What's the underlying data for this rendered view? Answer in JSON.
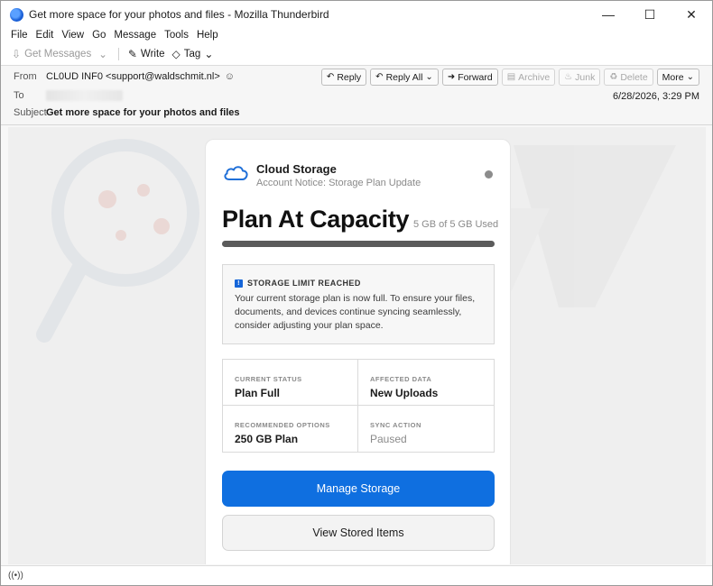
{
  "window": {
    "title": "Get more space for your photos and files - Mozilla Thunderbird",
    "controls": {
      "minimize": "—",
      "maximize": "☐",
      "close": "✕"
    }
  },
  "menu": [
    "File",
    "Edit",
    "View",
    "Go",
    "Message",
    "Tools",
    "Help"
  ],
  "toolbar": {
    "get_messages": "Get Messages",
    "write": "Write",
    "tag": "Tag"
  },
  "header": {
    "from_label": "From",
    "from_value": "CL0UD INF0 <support@waldschmit.nl>",
    "to_label": "To",
    "subject_label": "Subject",
    "subject_value": "Get more space for your photos and files",
    "date": "6/28/2026, 3:29 PM",
    "buttons": {
      "reply": "Reply",
      "reply_all": "Reply All",
      "forward": "Forward",
      "archive": "Archive",
      "junk": "Junk",
      "delete": "Delete",
      "more": "More"
    }
  },
  "email": {
    "brand_name": "Cloud Storage",
    "brand_sub": "Account Notice: Storage Plan Update",
    "plan_title": "Plan At Capacity",
    "plan_used": "5 GB of 5 GB Used",
    "usage_fraction": 1.0,
    "alert_head": "STORAGE LIMIT REACHED",
    "alert_text": "Your current storage plan is now full. To ensure your files, documents, and devices continue syncing seamlessly, consider adjusting your plan space.",
    "cells": [
      {
        "label": "CURRENT STATUS",
        "value": "Plan Full"
      },
      {
        "label": "AFFECTED DATA",
        "value": "New Uploads"
      },
      {
        "label": "RECOMMENDED OPTIONS",
        "value": "250 GB Plan"
      },
      {
        "label": "SYNC ACTION",
        "value": "Paused"
      }
    ],
    "primary_button": "Manage Storage",
    "secondary_button": "View Stored Items"
  },
  "colors": {
    "accent": "#0f6fe0",
    "watermark": "#e0e0e0"
  }
}
